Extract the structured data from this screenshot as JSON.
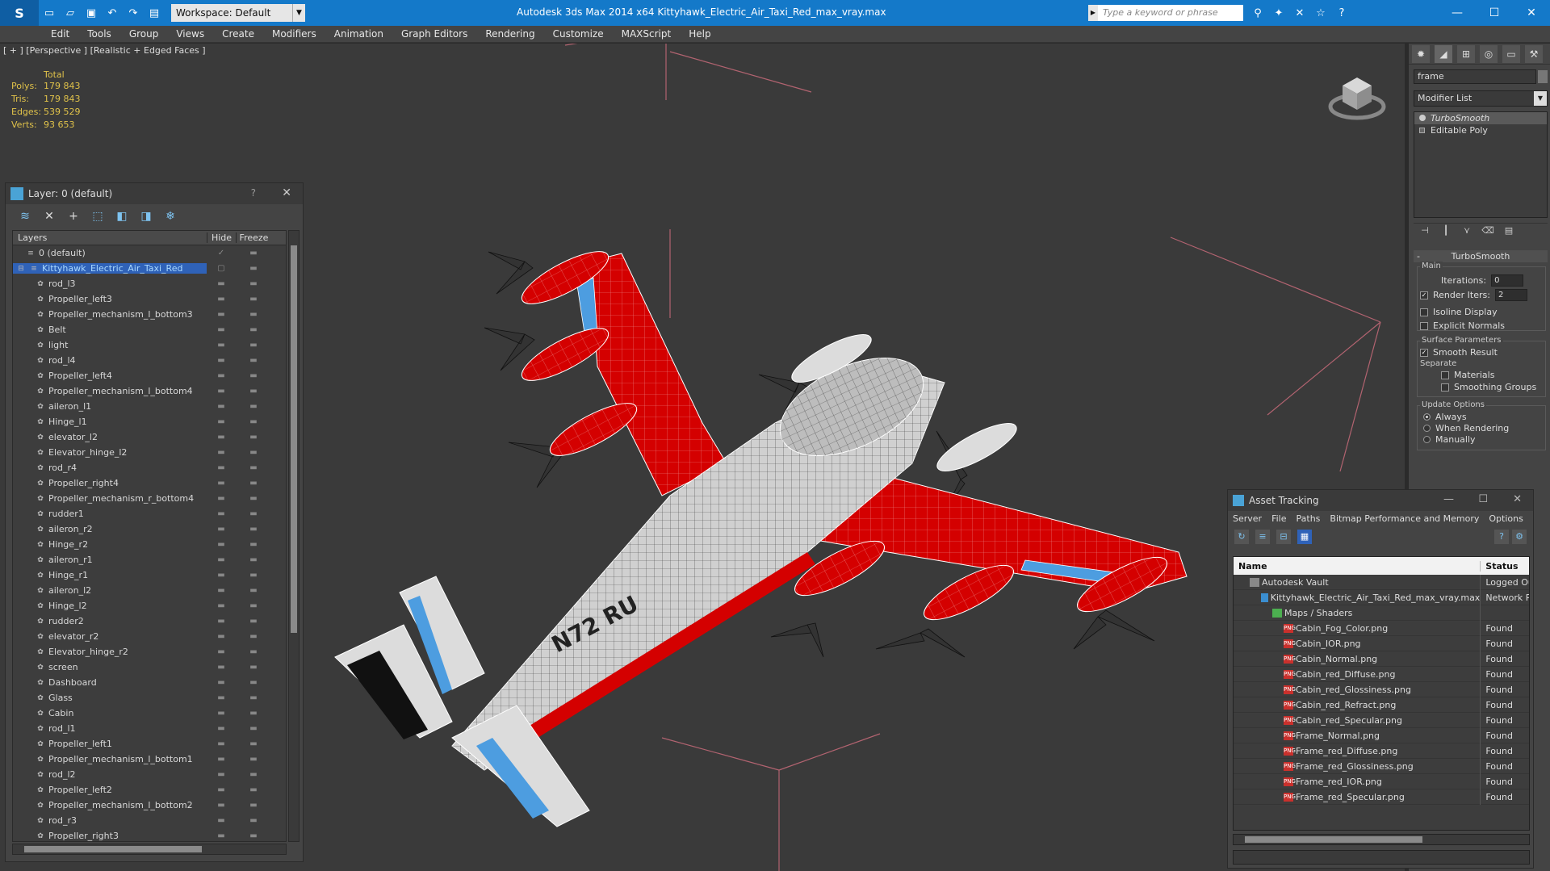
{
  "titlebar": {
    "workspace": "Workspace: Default",
    "title": "Autodesk 3ds Max  2014 x64     Kittyhawk_Electric_Air_Taxi_Red_max_vray.max",
    "search_placeholder": "Type a keyword or phrase"
  },
  "menu": [
    "Edit",
    "Tools",
    "Group",
    "Views",
    "Create",
    "Modifiers",
    "Animation",
    "Graph Editors",
    "Rendering",
    "Customize",
    "MAXScript",
    "Help"
  ],
  "viewport": {
    "label": "[ + ] [Perspective ] [Realistic + Edged Faces ]",
    "stats": {
      "header": "Total",
      "rows": [
        {
          "label": "Polys:",
          "value": "179 843"
        },
        {
          "label": "Tris:",
          "value": "179 843"
        },
        {
          "label": "Edges:",
          "value": "539 529"
        },
        {
          "label": "Verts:",
          "value": "93 653"
        }
      ]
    }
  },
  "layer_dialog": {
    "title": "Layer: 0 (default)",
    "help": "?",
    "columns": {
      "layers": "Layers",
      "hide": "Hide",
      "freeze": "Freeze"
    },
    "default_layer": "0 (default)",
    "selected_layer": "Kittyhawk_Electric_Air_Taxi_Red",
    "objects": [
      "rod_l3",
      "Propeller_left3",
      "Propeller_mechanism_l_bottom3",
      "Belt",
      "light",
      "rod_l4",
      "Propeller_left4",
      "Propeller_mechanism_l_bottom4",
      "aileron_l1",
      "Hinge_l1",
      "elevator_l2",
      "Elevator_hinge_l2",
      "rod_r4",
      "Propeller_right4",
      "Propeller_mechanism_r_bottom4",
      "rudder1",
      "aileron_r2",
      "Hinge_r2",
      "aileron_r1",
      "Hinge_r1",
      "aileron_l2",
      "Hinge_l2",
      "rudder2",
      "elevator_r2",
      "Elevator_hinge_r2",
      "screen",
      "Dashboard",
      "Glass",
      "Cabin",
      "rod_l1",
      "Propeller_left1",
      "Propeller_mechanism_l_bottom1",
      "rod_l2",
      "Propeller_left2",
      "Propeller_mechanism_l_bottom2",
      "rod_r3",
      "Propeller_right3"
    ]
  },
  "command_panel": {
    "object_name": "frame",
    "modifier_list": "Modifier List",
    "stack": [
      "TurboSmooth",
      "Editable Poly"
    ],
    "rollout": "TurboSmooth",
    "main_group": "Main",
    "iterations_label": "Iterations:",
    "iterations_value": "0",
    "render_iters_label": "Render Iters:",
    "render_iters_value": "2",
    "isoline_display": "Isoline Display",
    "explicit_normals": "Explicit Normals",
    "surface_parameters": "Surface Parameters",
    "smooth_result": "Smooth Result",
    "separate": "Separate",
    "materials": "Materials",
    "smoothing_groups": "Smoothing Groups",
    "update_options": "Update Options",
    "always": "Always",
    "when_rendering": "When Rendering",
    "manually": "Manually"
  },
  "asset_tracking": {
    "title": "Asset Tracking",
    "menu": [
      "Server",
      "File",
      "Paths",
      "Bitmap Performance and Memory",
      "Options"
    ],
    "columns": {
      "name": "Name",
      "status": "Status"
    },
    "rows": [
      {
        "name": "Autodesk Vault",
        "status": "Logged Ou",
        "indent": 1,
        "icon": "vault"
      },
      {
        "name": "Kittyhawk_Electric_Air_Taxi_Red_max_vray.max",
        "status": "Network Pa",
        "indent": 2,
        "icon": "max"
      },
      {
        "name": "Maps / Shaders",
        "status": "",
        "indent": 3,
        "icon": "maps"
      },
      {
        "name": "Cabin_Fog_Color.png",
        "status": "Found",
        "indent": 4,
        "icon": "png"
      },
      {
        "name": "Cabin_IOR.png",
        "status": "Found",
        "indent": 4,
        "icon": "png"
      },
      {
        "name": "Cabin_Normal.png",
        "status": "Found",
        "indent": 4,
        "icon": "png"
      },
      {
        "name": "Cabin_red_Diffuse.png",
        "status": "Found",
        "indent": 4,
        "icon": "png"
      },
      {
        "name": "Cabin_red_Glossiness.png",
        "status": "Found",
        "indent": 4,
        "icon": "png"
      },
      {
        "name": "Cabin_red_Refract.png",
        "status": "Found",
        "indent": 4,
        "icon": "png"
      },
      {
        "name": "Cabin_red_Specular.png",
        "status": "Found",
        "indent": 4,
        "icon": "png"
      },
      {
        "name": "Frame_Normal.png",
        "status": "Found",
        "indent": 4,
        "icon": "png"
      },
      {
        "name": "Frame_red_Diffuse.png",
        "status": "Found",
        "indent": 4,
        "icon": "png"
      },
      {
        "name": "Frame_red_Glossiness.png",
        "status": "Found",
        "indent": 4,
        "icon": "png"
      },
      {
        "name": "Frame_red_IOR.png",
        "status": "Found",
        "indent": 4,
        "icon": "png"
      },
      {
        "name": "Frame_red_Specular.png",
        "status": "Found",
        "indent": 4,
        "icon": "png"
      }
    ]
  },
  "colors": {
    "titlebar": "#1479c9",
    "aircraft_red": "#d40000",
    "aircraft_white": "#e8e8e8",
    "panel_blue": "#4d9de0",
    "grid_pink": "#c86b7a",
    "selection": "#2f62b8"
  }
}
